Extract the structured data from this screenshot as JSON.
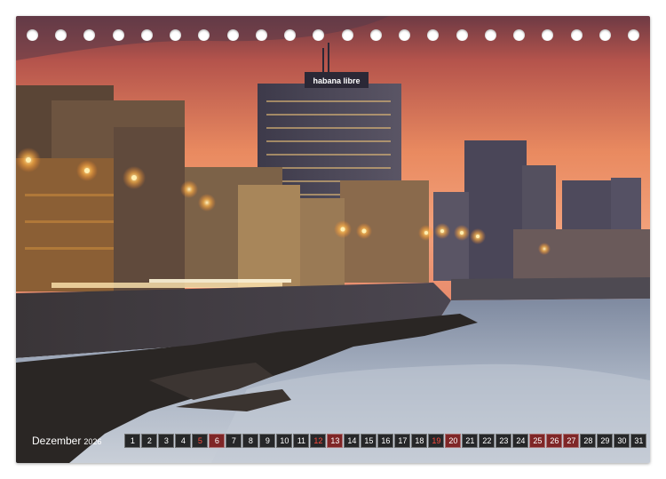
{
  "calendar": {
    "month": "Dezember",
    "year": "2026",
    "days": [
      {
        "n": "1",
        "kind": "weekday"
      },
      {
        "n": "2",
        "kind": "weekday"
      },
      {
        "n": "3",
        "kind": "weekday"
      },
      {
        "n": "4",
        "kind": "weekday"
      },
      {
        "n": "5",
        "kind": "saturday"
      },
      {
        "n": "6",
        "kind": "sunday"
      },
      {
        "n": "7",
        "kind": "weekday"
      },
      {
        "n": "8",
        "kind": "weekday"
      },
      {
        "n": "9",
        "kind": "weekday"
      },
      {
        "n": "10",
        "kind": "weekday"
      },
      {
        "n": "11",
        "kind": "weekday"
      },
      {
        "n": "12",
        "kind": "saturday"
      },
      {
        "n": "13",
        "kind": "sunday"
      },
      {
        "n": "14",
        "kind": "weekday"
      },
      {
        "n": "15",
        "kind": "weekday"
      },
      {
        "n": "16",
        "kind": "weekday"
      },
      {
        "n": "17",
        "kind": "weekday"
      },
      {
        "n": "18",
        "kind": "weekday"
      },
      {
        "n": "19",
        "kind": "saturday"
      },
      {
        "n": "20",
        "kind": "sunday"
      },
      {
        "n": "21",
        "kind": "weekday"
      },
      {
        "n": "22",
        "kind": "weekday"
      },
      {
        "n": "23",
        "kind": "weekday"
      },
      {
        "n": "24",
        "kind": "weekday"
      },
      {
        "n": "25",
        "kind": "holiday"
      },
      {
        "n": "26",
        "kind": "holiday"
      },
      {
        "n": "27",
        "kind": "sunday"
      },
      {
        "n": "28",
        "kind": "weekday"
      },
      {
        "n": "29",
        "kind": "weekday"
      },
      {
        "n": "30",
        "kind": "weekday"
      },
      {
        "n": "31",
        "kind": "weekday"
      }
    ]
  },
  "photo": {
    "hotel_sign": "habana libre"
  },
  "binding": {
    "hole_count": 22
  },
  "colors": {
    "sky_top": "#7a3b3f",
    "sky_glow": "#f0875a",
    "water": "#9aa8b8",
    "streetlight": "#ffb347",
    "holiday": "#c0392b"
  }
}
